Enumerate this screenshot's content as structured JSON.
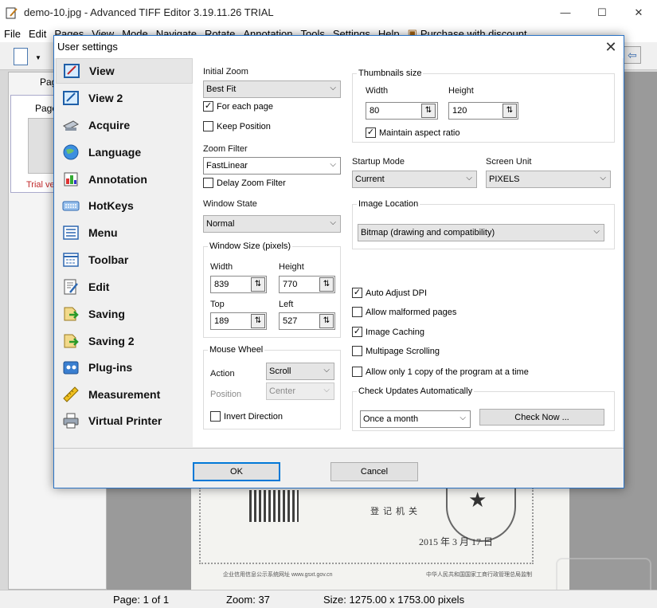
{
  "app": {
    "title": "demo-10.jpg - Advanced TIFF Editor 3.19.11.26 TRIAL",
    "window_controls": [
      "—",
      "☐",
      "✕"
    ],
    "menu": [
      "File",
      "Edit",
      "Pages",
      "View",
      "Mode",
      "Navigate",
      "Rotate",
      "Annotation",
      "Tools",
      "Settings",
      "Help"
    ],
    "purchase_label": "Purchase with discount",
    "left_panel": {
      "tab_label": "Pag",
      "thumb_label": "Page",
      "trial_label": "Trial ve"
    },
    "status": {
      "page": "Page: 1 of 1",
      "zoom": "Zoom: 37",
      "size": "Size: 1275.00 x 1753.00 pixels"
    }
  },
  "document_preview": {
    "line1": "登记机关",
    "date": "2015 年 3 月 17 日",
    "footer_left": "企业信用信息公示系统网址 www.gsxt.gov.cn",
    "footer_right": "中华人民共和国国家工商行政管理总局监制"
  },
  "dialog": {
    "title": "User settings",
    "close_glyph": "✕",
    "nav": [
      {
        "label": "View",
        "icon": "view-icon",
        "selected": true
      },
      {
        "label": "View 2",
        "icon": "view2-icon"
      },
      {
        "label": "Acquire",
        "icon": "scanner-icon"
      },
      {
        "label": "Language",
        "icon": "globe-icon"
      },
      {
        "label": "Annotation",
        "icon": "annotation-icon"
      },
      {
        "label": "HotKeys",
        "icon": "keyboard-icon"
      },
      {
        "label": "Menu",
        "icon": "menu-icon"
      },
      {
        "label": "Toolbar",
        "icon": "toolbar-icon"
      },
      {
        "label": "Edit",
        "icon": "edit-icon"
      },
      {
        "label": "Saving",
        "icon": "save-icon"
      },
      {
        "label": "Saving 2",
        "icon": "save2-icon"
      },
      {
        "label": "Plug-ins",
        "icon": "plugin-icon"
      },
      {
        "label": "Measurement",
        "icon": "ruler-icon"
      },
      {
        "label": "Virtual Printer",
        "icon": "printer-icon"
      }
    ],
    "view": {
      "initial_zoom": {
        "label": "Initial Zoom",
        "value": "Best Fit"
      },
      "for_each_page": {
        "label": "For each page",
        "checked": true
      },
      "keep_position": {
        "label": "Keep Position",
        "checked": false
      },
      "zoom_filter": {
        "label": "Zoom Filter",
        "value": "FastLinear"
      },
      "delay_zoom_filter": {
        "label": "Delay Zoom Filter",
        "checked": false
      },
      "window_state": {
        "label": "Window State",
        "value": "Normal"
      },
      "window_size": {
        "title": "Window Size (pixels)",
        "width_label": "Width",
        "width": "839",
        "height_label": "Height",
        "height": "770",
        "top_label": "Top",
        "top": "189",
        "left_label": "Left",
        "left": "527"
      },
      "mouse_wheel": {
        "title": "Mouse Wheel",
        "action_label": "Action",
        "action": "Scroll",
        "position_label": "Position",
        "position": "Center",
        "invert": {
          "label": "Invert Direction",
          "checked": false
        }
      },
      "thumbnails": {
        "title": "Thumbnails size",
        "width_label": "Width",
        "width": "80",
        "height_label": "Height",
        "height": "120",
        "maintain": {
          "label": "Maintain aspect ratio",
          "checked": true
        }
      },
      "startup_mode": {
        "label": "Startup Mode",
        "value": "Current"
      },
      "screen_unit": {
        "label": "Screen Unit",
        "value": "PIXELS"
      },
      "image_location": {
        "title": "Image Location",
        "value": "Bitmap (drawing and compatibility)"
      },
      "options": [
        {
          "label": "Auto Adjust DPI",
          "checked": true
        },
        {
          "label": "Allow malformed pages",
          "checked": false
        },
        {
          "label": "Image Caching",
          "checked": true
        },
        {
          "label": "Multipage Scrolling",
          "checked": false
        },
        {
          "label": "Allow only 1 copy of the program at a time",
          "checked": false
        }
      ],
      "check_updates": {
        "title": "Check Updates Automatically",
        "value": "Once a month",
        "button": "Check Now ..."
      }
    },
    "ok": "OK",
    "cancel": "Cancel"
  }
}
